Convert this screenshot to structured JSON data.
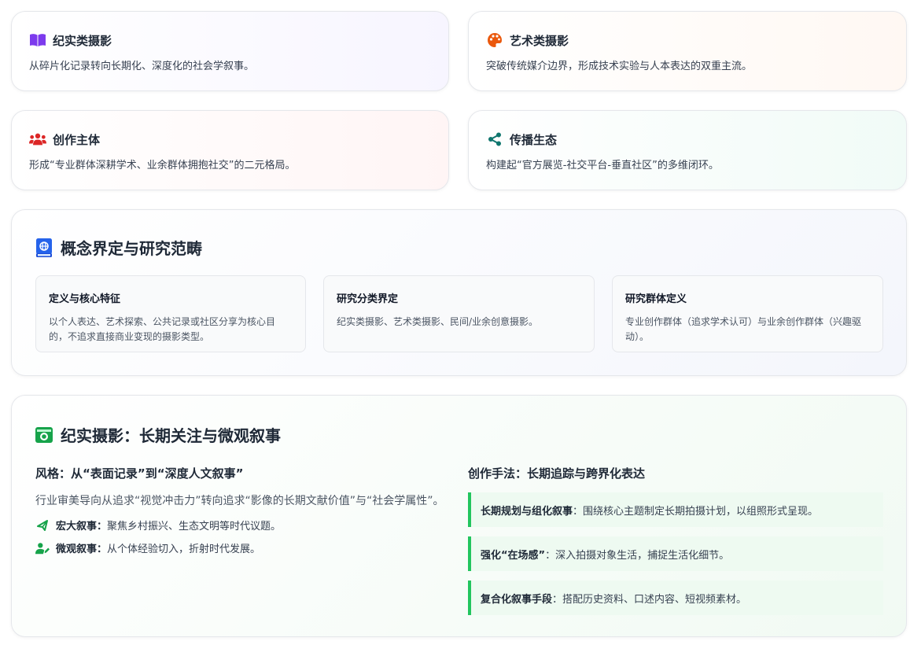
{
  "cards": [
    {
      "icon": "book-open-icon",
      "title": "纪实类摄影",
      "desc": "从碎片化记录转向长期化、深度化的社会学叙事。",
      "color": "#7c3aed"
    },
    {
      "icon": "palette-icon",
      "title": "艺术类摄影",
      "desc": "突破传统媒介边界，形成技术实验与人本表达的双重主流。",
      "color": "#ea580c"
    },
    {
      "icon": "users-icon",
      "title": "创作主体",
      "desc": "形成“专业群体深耕学术、业余群体拥抱社交”的二元格局。",
      "color": "#dc2626"
    },
    {
      "icon": "share-nodes-icon",
      "title": "传播生态",
      "desc": "构建起“官方展览-社交平台-垂直社区”的多维闭环。",
      "color": "#0f766e"
    }
  ],
  "concept": {
    "icon": "book-globe-icon",
    "title": "概念界定与研究范畴",
    "items": [
      {
        "title": "定义与核心特征",
        "desc": "以个人表达、艺术探索、公共记录或社区分享为核心目的，不追求直接商业变现的摄影类型。"
      },
      {
        "title": "研究分类界定",
        "desc": "纪实类摄影、艺术类摄影、民间/业余创意摄影。"
      },
      {
        "title": "研究群体定义",
        "desc": "专业创作群体（追求学术认可）与业余创作群体（兴趣驱动）。"
      }
    ],
    "color": "#2563eb"
  },
  "documentary": {
    "icon": "camera-retro-icon",
    "title": "纪实摄影：长期关注与微观叙事",
    "color": "#16a34a",
    "style": {
      "title": "风格：从“表面记录”到“深度人文叙事”",
      "intro": "行业审美导向从追求“视觉冲击力”转向追求“影像的长期文献价值”与“社会学属性”。",
      "bullets": [
        {
          "icon": "bullhorn-icon",
          "label": "宏大叙事：",
          "text": "聚焦乡村振兴、生态文明等时代议题。"
        },
        {
          "icon": "user-edit-icon",
          "label": "微观叙事：",
          "text": "从个体经验切入，折射时代发展。"
        }
      ]
    },
    "method": {
      "title": "创作手法：长期追踪与跨界化表达",
      "items": [
        {
          "label": "长期规划与组化叙事",
          "text": "：围绕核心主题制定长期拍摄计划，以组照形式呈现。"
        },
        {
          "label": "强化“在场感”",
          "text": "：深入拍摄对象生活，捕捉生活化细节。"
        },
        {
          "label": "复合化叙事手段",
          "text": "：搭配历史资料、口述内容、短视频素材。"
        }
      ]
    }
  }
}
